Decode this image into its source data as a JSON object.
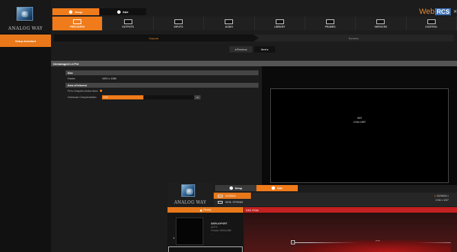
{
  "logo": {
    "text": "ANALOG WAY"
  },
  "mode_tabs": [
    {
      "label": "Setup",
      "active": true
    },
    {
      "label": "Edit",
      "active": false
    }
  ],
  "brand": {
    "web": "Web",
    "rcs": "RCS",
    "close": "✕"
  },
  "menu": [
    {
      "label": "PRECONFIG",
      "active": true
    },
    {
      "label": "OUTPUTS",
      "active": false
    },
    {
      "label": "INPUTS",
      "active": false
    },
    {
      "label": "AUDIO",
      "active": false
    },
    {
      "label": "LIBRARY",
      "active": false
    },
    {
      "label": "FRAMES",
      "active": false
    },
    {
      "label": "SERVICES",
      "active": false
    },
    {
      "label": "CONTROL",
      "active": false
    }
  ],
  "sidebar": {
    "items": [
      {
        "label": "Setup Assistant"
      }
    ]
  },
  "steps": [
    {
      "label": "Outputs",
      "active": true
    },
    {
      "label": "Screens",
      "active": false
    }
  ],
  "nav": {
    "previous": "◂ Previous",
    "next": "Next ▸"
  },
  "sub_header": "Unmanaged Lvl Pnl",
  "size_section": {
    "title": "Size",
    "rows": [
      {
        "label": "Raster",
        "value": "1920 x 1080"
      }
    ]
  },
  "aoi_section": {
    "title": "Area of Interest",
    "fit_label": "Fit to Output's Active Area",
    "overscan_label": "Overscan Compensation",
    "overscan_value": "0 %",
    "overscan_percent": 45
  },
  "preview": {
    "title": "AOI",
    "size": "1744 x 997"
  },
  "overlay": {
    "logo_text": "ANALOG WAY",
    "mode_tabs": [
      {
        "label": "Setup"
      },
      {
        "label": "Edit"
      }
    ],
    "list": [
      {
        "label": "SCREEN",
        "selected": true
      },
      {
        "label": "MON. STREAM",
        "selected": false
      }
    ],
    "right_label": "SCREEN 1",
    "right_size": "1744 x 1227",
    "ready_label": "Ready",
    "red_bar_label": "ER1 PGM",
    "card": {
      "num": "1",
      "title": "DISPLAYPORT",
      "line2": "AUTO",
      "line3": "Format: 1920x1080",
      "line4": "..."
    },
    "markers": [
      "1",
      "2"
    ]
  }
}
